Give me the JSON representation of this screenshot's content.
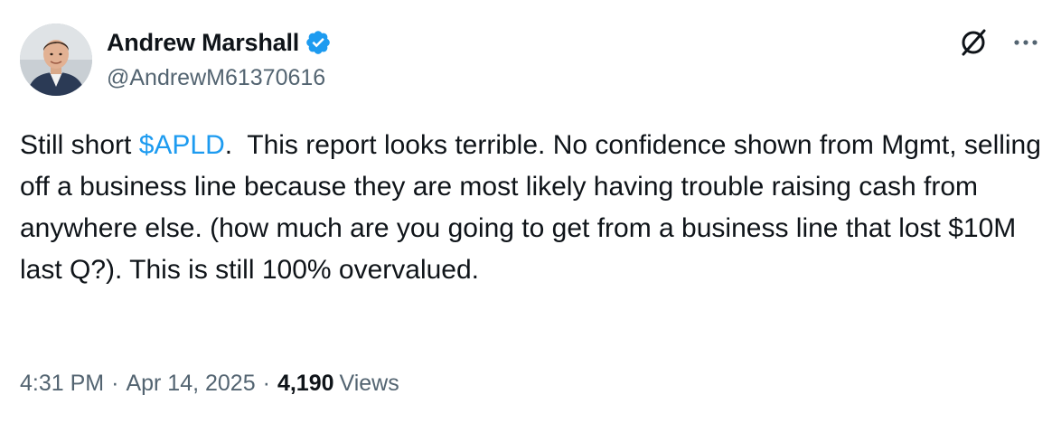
{
  "author": {
    "name": "Andrew Marshall",
    "handle": "@AndrewM61370616",
    "verified_color": "#1d9bf0"
  },
  "actions": {
    "grok_icon": "grok-icon",
    "more_icon": "more-icon"
  },
  "tweet": {
    "text_before": "Still short ",
    "cashtag": "$APLD",
    "text_after": ".  This report looks terrible. No confidence shown from Mgmt, selling off a business line because they are most likely having trouble raising cash from anywhere else. (how much are you going to get from a business line that lost $10M last Q?). This is still 100% overvalued."
  },
  "meta": {
    "time": "4:31 PM",
    "separator": "·",
    "date": "Apr 14, 2025",
    "views_count": "4,190",
    "views_label": "Views"
  },
  "colors": {
    "link": "#1d9bf0",
    "text": "#0f1419",
    "secondary": "#536471"
  }
}
